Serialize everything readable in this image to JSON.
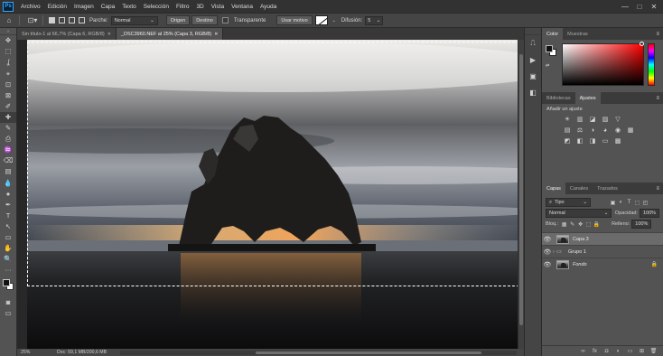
{
  "app": {
    "logo_text": "Ps"
  },
  "menu": [
    "Archivo",
    "Edición",
    "Imagen",
    "Capa",
    "Texto",
    "Selección",
    "Filtro",
    "3D",
    "Vista",
    "Ventana",
    "Ayuda"
  ],
  "window_controls": [
    "—",
    "□",
    "✕"
  ],
  "options": {
    "parche_label": "Parche:",
    "parche_value": "Normal",
    "origen_label": "Origen",
    "destino_label": "Destino",
    "transparente_label": "Transparente",
    "usar_motivo_label": "Usar motivo",
    "difusion_label": "Difusión:",
    "difusion_value": "5"
  },
  "tabs": [
    {
      "title": "Sin título-1 al 66,7% (Capa 6, RGB/8)",
      "close": "✕"
    },
    {
      "title": "_DSC3960.NEF al 25% (Capa 3, RGB/8)",
      "close": "✕"
    }
  ],
  "tools": [
    "✥",
    "⬚",
    "ʆ",
    "⌖",
    "⊡",
    "⊠",
    "✐",
    "✚",
    "✎",
    "⎙",
    "♒",
    "⌫",
    "▤",
    "💧",
    "●",
    "✒",
    "T",
    "↖",
    "▭",
    "✋",
    "🔍",
    "···"
  ],
  "status": {
    "zoom": "25%",
    "doc": "Doc: 59,1 MB/200,6 MB"
  },
  "dock_icons": [
    "⎍",
    "▶",
    "▣",
    "◧"
  ],
  "color_panel": {
    "tabs": [
      "Color",
      "Muestras"
    ],
    "menu": "≡"
  },
  "adjust_panel": {
    "tabs": [
      "Bibliotecas",
      "Ajustes"
    ],
    "title": "Añadir un ajuste",
    "row1": [
      "☀",
      "▥",
      "◪",
      "▨",
      "▽"
    ],
    "row2": [
      "▤",
      "⚖",
      "◑",
      "◕",
      "◉",
      "▦"
    ],
    "row3": [
      "◩",
      "◧",
      "◨",
      "▭",
      "▩"
    ]
  },
  "layers_panel": {
    "tabs": [
      "Capas",
      "Canales",
      "Trazados"
    ],
    "filter_value": "Tipo",
    "filter_icons": [
      "▣",
      "◐",
      "T",
      "⬚",
      "◰"
    ],
    "blend_mode": "Normal",
    "opacity_label": "Opacidad:",
    "opacity_value": "100%",
    "lock_label": "Bloq.:",
    "lock_icons": [
      "▦",
      "✎",
      "✥",
      "⬚",
      "🔒"
    ],
    "fill_label": "Relleno:",
    "fill_value": "100%",
    "layers": [
      {
        "name": "Capa 3",
        "type": "image",
        "selected": true
      },
      {
        "name": "Grupo 1",
        "type": "group",
        "selected": false
      },
      {
        "name": "Fondo",
        "type": "image",
        "selected": false,
        "locked": true
      }
    ],
    "footer_icons": [
      "∞",
      "fx",
      "◘",
      "◐",
      "▭",
      "⊞",
      "🗑"
    ]
  }
}
